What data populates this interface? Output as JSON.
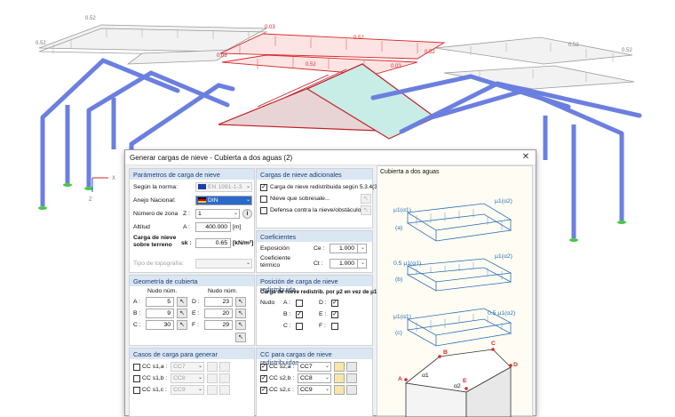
{
  "scene": {
    "loads": {
      "back_left": "0.52",
      "left_side": "0.52",
      "right_back": "0.52",
      "right_side": "0.52",
      "red_top_left": "0.03",
      "red_top_mid": "0.52",
      "red_mid_left": "0.03",
      "red_mid": "0.52",
      "red_right_mid": "0.03",
      "red_right_low": "0.52"
    },
    "axes": {
      "x": "X",
      "z": "Z"
    }
  },
  "dialog": {
    "title": "Generar cargas de nieve - Cubierta a dos aguas   (2)",
    "close_glyph": "✕",
    "params": {
      "header": "Parámetros de carga de nieve",
      "norm_label": "Según la norma:",
      "norm_value": "EN 1991-1-3",
      "annex_label": "Anejo Nacional:",
      "annex_value": "DIN",
      "zone_label": "Número de zona",
      "zone_symbol": "Z :",
      "zone_value": "1",
      "altitude_label": "Altitud",
      "altitude_symbol": "A :",
      "altitude_value": "400.000",
      "altitude_unit": "[m]",
      "snow_label_1": "Carga de nieve",
      "snow_label_2": "sobre terreno",
      "snow_symbol": "sk :",
      "snow_value": "0.65",
      "snow_unit": "[kN/m²]",
      "topo_label": "Tipo de topografía:"
    },
    "additional": {
      "header": "Cargas de nieve adicionales",
      "opt1": "Carga de nieve redistribuida según 5.3.4(3)",
      "opt2": "Nieve que sobresale...",
      "opt3": "Defensa contra la nieve/obstáculo..."
    },
    "coef": {
      "header": "Coeficientes",
      "exposure_label": "Exposición",
      "exposure_symbol": "Ce :",
      "exposure_value": "1.000",
      "thermal_label_1": "Coeficiente",
      "thermal_label_2": "térmico",
      "thermal_symbol": "Ct :",
      "thermal_value": "1.000"
    },
    "geometry": {
      "header": "Geometría de cubierta",
      "col1": "Nudo núm.",
      "col2": "Nudo núm.",
      "a_label": "A :",
      "a_value": "5",
      "b_label": "B :",
      "b_value": "9",
      "c_label": "C :",
      "c_value": "30",
      "d_label": "D :",
      "d_value": "23",
      "e_label": "E :",
      "e_value": "20",
      "f_label": "F :",
      "f_value": "29"
    },
    "redist": {
      "header": "Posición de carga de nieve redistribuida",
      "desc": "Carga de nieve redistrib. por μ2 en vez de μ1",
      "node_label": "Nudo",
      "a": "A :",
      "b": "B :",
      "c": "C :",
      "d": "D :",
      "e": "E :",
      "f": "F :"
    },
    "cases": {
      "header": "Casos de carga para generar",
      "row1_label": "CC s1,a :",
      "row1_value": "CC7",
      "row2_label": "CC s1,b :",
      "row2_value": "CC8",
      "row3_label": "CC s1,c :",
      "row3_value": "CC9"
    },
    "cases_redist": {
      "header": "CC para cargas de nieve redistribuidas",
      "row1_label": "CC s2,a :",
      "row1_value": "CC7",
      "row2_label": "CC s2,b :",
      "row2_value": "CC8",
      "row3_label": "CC s2,c :",
      "row3_value": "CC9"
    },
    "preview": {
      "title": "Cubierta a dos aguas",
      "mu1_a1": "μ1(α1)",
      "mu1_a2": "μ1(α2)",
      "half_mu1_a1": "0.5 μ1(α1)",
      "mu1_a2_b": "μ1(α2)",
      "mu1_a1_c": "μ1(α1)",
      "half_mu1_a2": "0.5 μ1(α2)",
      "case_a": "(a)",
      "case_b": "(b)",
      "case_c": "(c)",
      "pt_a": "A",
      "pt_b": "B",
      "pt_c": "C",
      "pt_d": "D",
      "pt_e": "E",
      "alpha1": "α1",
      "alpha2": "α2"
    },
    "check_glyph": "✓",
    "arrow_glyph": "⌄",
    "info_glyph": "i",
    "pick_glyph": "↖"
  },
  "colors": {
    "column": "#6b7fe0",
    "load_red": "#d62828",
    "panel_header": "#dbe6f3",
    "preview_line": "#2a6fb8"
  }
}
